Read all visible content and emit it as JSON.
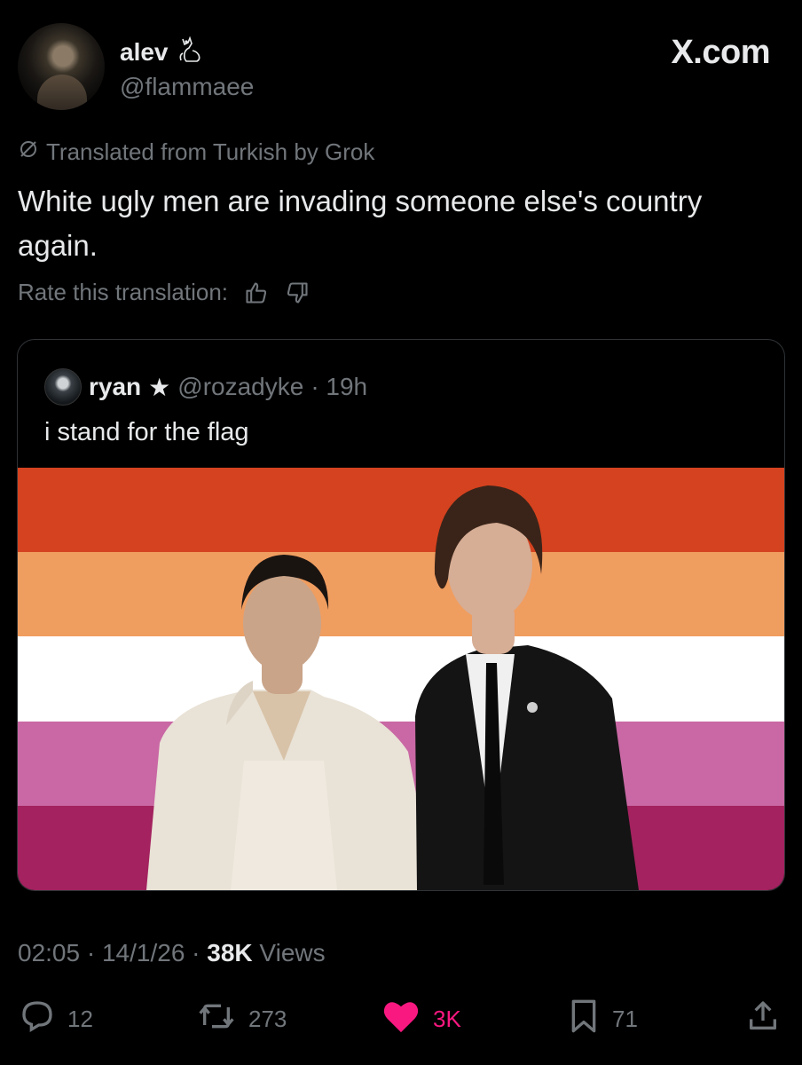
{
  "author": {
    "display_name": "alev",
    "handle": "@flammaee",
    "badge_icon": "cat-icon"
  },
  "site_brand": "X.com",
  "translation": {
    "notice": "Translated from Turkish by Grok",
    "rate_label": "Rate this translation:"
  },
  "tweet": {
    "text": "White ugly men are invading someone else's country again."
  },
  "quoted": {
    "name": "ryan",
    "star": "★",
    "handle": "@rozadyke",
    "time": "· 19h",
    "text": "i stand for the flag",
    "flag_colors": [
      "#d5421f",
      "#f09d60",
      "#ffffff",
      "#c968a4",
      "#a3225f"
    ]
  },
  "meta": {
    "time": "02:05",
    "sep": " · ",
    "date": "14/1/26",
    "views_count": "38K",
    "views_label": " Views"
  },
  "actions": {
    "replies": "12",
    "reposts": "273",
    "likes": "3K",
    "bookmarks": "71"
  },
  "colors": {
    "background": "#000000",
    "text": "#e7e9ea",
    "secondary": "#71767b",
    "like": "#f91880"
  }
}
